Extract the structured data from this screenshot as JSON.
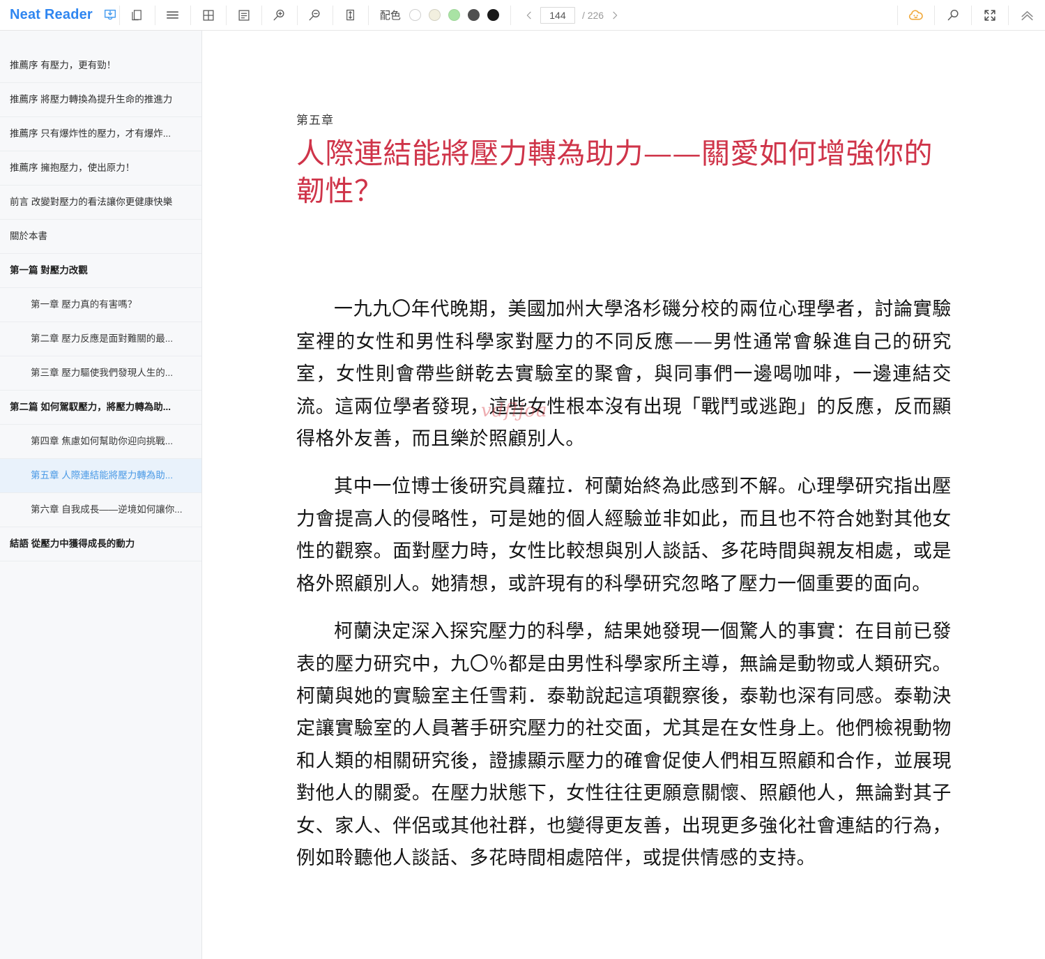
{
  "app": {
    "brand": "Neat Reader",
    "save_icon": "download-tray-icon"
  },
  "toolbar": {
    "buttons": [
      {
        "name": "copy-pages-icon",
        "title": "copy-pages"
      },
      {
        "name": "list-lines-icon",
        "title": "scroll-mode"
      },
      {
        "name": "grid-layout-icon",
        "title": "two-page-mode"
      },
      {
        "name": "notes-panel-icon",
        "title": "notes"
      },
      {
        "name": "zoom-in-icon",
        "title": "zoom-in"
      },
      {
        "name": "zoom-out-icon",
        "title": "zoom-out"
      },
      {
        "name": "fit-height-icon",
        "title": "fit-height"
      }
    ],
    "palette_label": "配色",
    "swatches": [
      {
        "name": "swatch-white",
        "color": "#ffffff",
        "selected": true
      },
      {
        "name": "swatch-cream",
        "color": "#f2efdf",
        "selected": false
      },
      {
        "name": "swatch-green",
        "color": "#a9e3a4",
        "selected": false
      },
      {
        "name": "swatch-gray",
        "color": "#4f4f4f",
        "selected": false
      },
      {
        "name": "swatch-black",
        "color": "#1a1a1a",
        "selected": false
      }
    ],
    "pager": {
      "prev": "‹",
      "next": "›",
      "current_page": "144",
      "total_label": "/ 226",
      "total": "226"
    },
    "right_buttons": [
      {
        "name": "cloud-sync-icon",
        "title": "cloud-sync",
        "color": "#f0a93c"
      },
      {
        "name": "search-icon",
        "title": "search",
        "color": "#4a4a4a"
      },
      {
        "name": "fullscreen-icon",
        "title": "fullscreen",
        "color": "#4a4a4a"
      },
      {
        "name": "collapse-up-icon",
        "title": "collapse",
        "color": "#8a8a8a"
      }
    ]
  },
  "sidebar": {
    "items": [
      {
        "label": "推薦序 有壓力，更有勁！",
        "level": 0,
        "active": false
      },
      {
        "label": "推薦序 將壓力轉換為提升生命的推進力",
        "level": 0,
        "active": false
      },
      {
        "label": "推薦序 只有爆炸性的壓力，才有爆炸...",
        "level": 0,
        "active": false
      },
      {
        "label": "推薦序 擁抱壓力，使出原力！",
        "level": 0,
        "active": false
      },
      {
        "label": "前言 改變對壓力的看法讓你更健康快樂",
        "level": 0,
        "active": false
      },
      {
        "label": "關於本書",
        "level": 0,
        "active": false
      },
      {
        "label": "第一篇 對壓力改觀",
        "level": 1,
        "active": false
      },
      {
        "label": "第一章 壓力真的有害嗎？",
        "level": 2,
        "active": false
      },
      {
        "label": "第二章 壓力反應是面對難關的最...",
        "level": 2,
        "active": false
      },
      {
        "label": "第三章 壓力驅使我們發現人生的...",
        "level": 2,
        "active": false
      },
      {
        "label": "第二篇 如何駕馭壓力，將壓力轉為助...",
        "level": 1,
        "active": false
      },
      {
        "label": "第四章 焦慮如何幫助你迎向挑戰...",
        "level": 2,
        "active": false
      },
      {
        "label": "第五章 人際連結能將壓力轉為助...",
        "level": 2,
        "active": true
      },
      {
        "label": "第六章 自我成長——逆境如何讓你...",
        "level": 2,
        "active": false
      },
      {
        "label": "結語 從壓力中獲得成長的動力",
        "level": 1,
        "active": false
      }
    ]
  },
  "content": {
    "chapter_number": "第五章",
    "chapter_title": "人際連結能將壓力轉為助力——關愛如何增強你的韌性？",
    "watermark": "vdfljoa",
    "paragraphs": [
      "一九九〇年代晚期，美國加州大學洛杉磯分校的兩位心理學者，討論實驗室裡的女性和男性科學家對壓力的不同反應——男性通常會躲進自己的研究室，女性則會帶些餅乾去實驗室的聚會，與同事們一邊喝咖啡，一邊連結交流。這兩位學者發現，這些女性根本沒有出現「戰鬥或逃跑」的反應，反而顯得格外友善，而且樂於照顧別人。",
      "其中一位博士後研究員蘿拉．柯蘭始終為此感到不解。心理學研究指出壓力會提高人的侵略性，可是她的個人經驗並非如此，而且也不符合她對其他女性的觀察。面對壓力時，女性比較想與別人談話、多花時間與親友相處，或是格外照顧別人。她猜想，或許現有的科學研究忽略了壓力一個重要的面向。",
      "柯蘭決定深入探究壓力的科學，結果她發現一個驚人的事實：在目前已發表的壓力研究中，九〇％都是由男性科學家所主導，無論是動物或人類研究。柯蘭與她的實驗室主任雪莉．泰勒說起這項觀察後，泰勒也深有同感。泰勒決定讓實驗室的人員著手研究壓力的社交面，尤其是在女性身上。他們檢視動物和人類的相關研究後，證據顯示壓力的確會促使人們相互照顧和合作，並展現對他人的關愛。在壓力狀態下，女性往往更願意關懷、照顧他人，無論對其子女、家人、伴侶或其他社群，也變得更友善，出現更多強化社會連結的行為，例如聆聽他人談話、多花時間相處陪伴，或提供情感的支持。"
    ]
  },
  "colors": {
    "brand_blue": "#2f86f0",
    "title_red": "#cf3449",
    "active_bg": "#e9f2fb",
    "active_text": "#4b9ae6",
    "cloud_orange": "#f0a93c"
  }
}
